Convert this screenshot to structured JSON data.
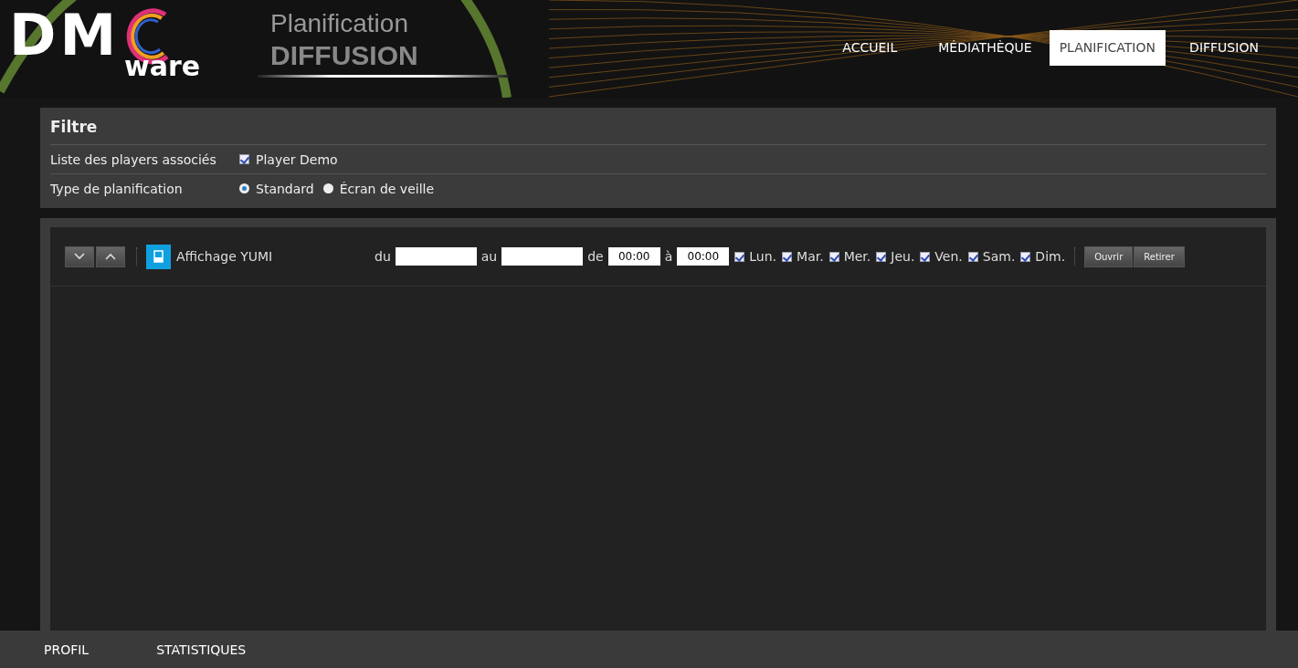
{
  "logo": {
    "letters": "DM",
    "suffix": "ware"
  },
  "banner": {
    "line1": "Planification",
    "line2": "DIFFUSION"
  },
  "nav": [
    {
      "label": "ACCUEIL",
      "selected": false
    },
    {
      "label": "MÉDIATHÈQUE",
      "selected": false
    },
    {
      "label": "PLANIFICATION",
      "selected": true
    },
    {
      "label": "DIFFUSION",
      "selected": false
    }
  ],
  "filter": {
    "title": "Filtre",
    "players": {
      "label": "Liste des players associés",
      "items": [
        {
          "label": "Player Demo",
          "checked": true
        }
      ]
    },
    "type": {
      "label": "Type de planification",
      "options": [
        {
          "label": "Standard",
          "selected": true
        },
        {
          "label": "Écran de veille",
          "selected": false
        }
      ]
    }
  },
  "schedule": [
    {
      "name": "Affichage YUMI",
      "from_label": "du",
      "to_label": "au",
      "start_label": "de",
      "start": "00:00",
      "end_label": "à",
      "end": "00:00",
      "days": [
        {
          "label": "Lun.",
          "checked": true
        },
        {
          "label": "Mar.",
          "checked": true
        },
        {
          "label": "Mer.",
          "checked": true
        },
        {
          "label": "Jeu.",
          "checked": true
        },
        {
          "label": "Ven.",
          "checked": true
        },
        {
          "label": "Sam.",
          "checked": true
        },
        {
          "label": "Dim.",
          "checked": true
        }
      ],
      "buttons": [
        "Ouvrir",
        "Retirer"
      ]
    }
  ],
  "footer": [
    {
      "label": "PROFIL"
    },
    {
      "label": "STATISTIQUES"
    }
  ]
}
